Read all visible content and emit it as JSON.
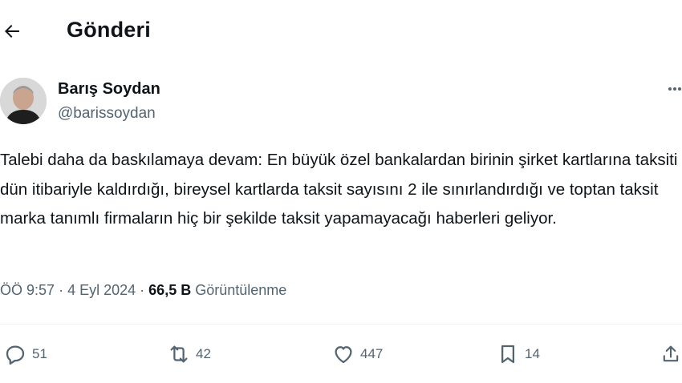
{
  "header": {
    "title": "Gönderi",
    "back_icon": "arrow-left-icon"
  },
  "author": {
    "name": "Barış Soydan",
    "handle": "@barissoydan"
  },
  "post": {
    "text": "Talebi daha da baskılamaya devam: En büyük özel bankalardan birinin şirket kartlarına taksiti dün itibariyle kaldırdığı, bireysel kartlarda taksit sayısını 2 ile sınırlandırdığı ve toptan taksit marka tanımlı firmaların hiç bir şekilde taksit yapamayacağı haberleri geliyor."
  },
  "meta": {
    "time": "ÖÖ 9:57",
    "separator": "·",
    "date": "4 Eyl 2024",
    "views_count": "66,5 B",
    "views_label": "Görüntülenme"
  },
  "actions": {
    "replies": "51",
    "reposts": "42",
    "likes": "447",
    "bookmarks": "14"
  },
  "colors": {
    "text": "#0f1419",
    "secondary": "#536471",
    "divider": "#eff3f4"
  }
}
